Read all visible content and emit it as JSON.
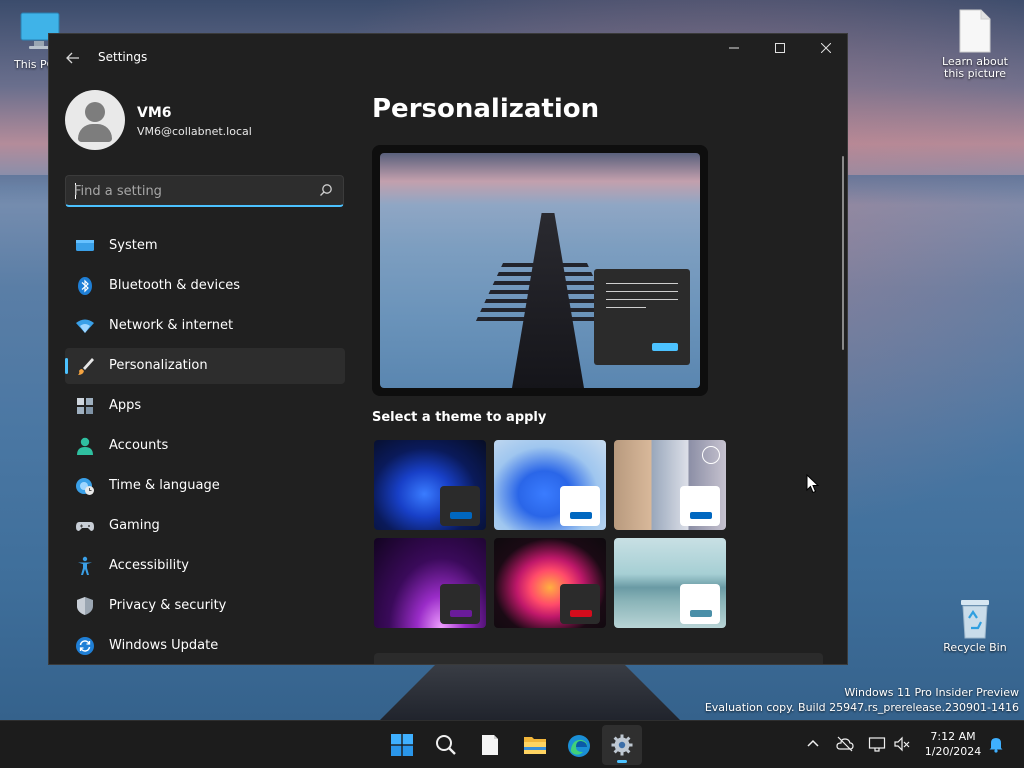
{
  "desktop": {
    "icons": [
      {
        "label": "This PC"
      },
      {
        "label": "Learn about this picture"
      },
      {
        "label": "Recycle Bin"
      }
    ],
    "watermark": {
      "line1": "Windows 11 Pro Insider Preview",
      "line2": "Evaluation copy. Build 25947.rs_prerelease.230901-1416"
    }
  },
  "window": {
    "title": "Settings",
    "controls": {
      "minimize": "—",
      "maximize": "☐",
      "close": "✕"
    },
    "profile": {
      "name": "VM6",
      "email": "VM6@collabnet.local"
    },
    "search": {
      "placeholder": "Find a setting",
      "value": ""
    },
    "nav": {
      "items": [
        {
          "label": "System",
          "icon": "system-icon"
        },
        {
          "label": "Bluetooth & devices",
          "icon": "bluetooth-icon"
        },
        {
          "label": "Network & internet",
          "icon": "wifi-icon"
        },
        {
          "label": "Personalization",
          "icon": "brush-icon",
          "selected": true
        },
        {
          "label": "Apps",
          "icon": "apps-icon"
        },
        {
          "label": "Accounts",
          "icon": "accounts-icon"
        },
        {
          "label": "Time & language",
          "icon": "globe-clock-icon"
        },
        {
          "label": "Gaming",
          "icon": "gamepad-icon"
        },
        {
          "label": "Accessibility",
          "icon": "accessibility-icon"
        },
        {
          "label": "Privacy & security",
          "icon": "shield-icon"
        },
        {
          "label": "Windows Update",
          "icon": "update-icon"
        }
      ]
    },
    "main": {
      "title": "Personalization",
      "theme_section_label": "Select a theme to apply",
      "themes": [
        {
          "name": "windows-dark",
          "accent": "#0067c0",
          "chip": "#2b2b2b"
        },
        {
          "name": "windows-light",
          "accent": "#0067c0",
          "chip": "#ffffff"
        },
        {
          "name": "glow-slideshow",
          "accent": "#0067c0",
          "chip": "#ffffff",
          "slideshow": true
        },
        {
          "name": "captured-motion",
          "accent": "#6a1b9a",
          "chip": "#2b2b2b"
        },
        {
          "name": "flow",
          "accent": "#d40c1c",
          "chip": "#2b2b2b"
        },
        {
          "name": "sunrise",
          "accent": "#4a8fa8",
          "chip": "#ffffff"
        }
      ]
    }
  },
  "taskbar": {
    "apps": [
      {
        "name": "start-button",
        "icon": "windows-logo-icon"
      },
      {
        "name": "search-button",
        "icon": "search-icon"
      },
      {
        "name": "notepad-button",
        "icon": "notepad-icon"
      },
      {
        "name": "file-explorer-button",
        "icon": "folder-icon"
      },
      {
        "name": "edge-button",
        "icon": "edge-icon"
      },
      {
        "name": "settings-button",
        "icon": "gear-icon",
        "active": true
      }
    ],
    "clock": {
      "time": "7:12 AM",
      "date": "1/20/2024"
    }
  }
}
